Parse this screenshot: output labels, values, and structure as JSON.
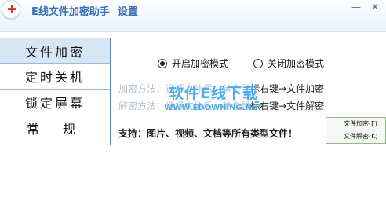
{
  "titlebar": {
    "title": "E线文件加密助手",
    "settings": "设置",
    "minimize_glyph": "—",
    "close_glyph": "✕"
  },
  "sidebar": {
    "items": [
      {
        "label": "文件加密",
        "active": true
      },
      {
        "label": "定时关机",
        "active": false
      },
      {
        "label": "锁定屏幕",
        "active": false
      },
      {
        "label": "常规",
        "active": false
      }
    ]
  },
  "panel": {
    "modes": [
      {
        "label": "开启加密模式",
        "selected": true
      },
      {
        "label": "关闭加密模式",
        "selected": false
      }
    ],
    "encrypt_hint_prefix": "加密方法：选择文件后，单击鼠",
    "encrypt_hint": "标右键→文件加密",
    "decrypt_hint_prefix": "解密方法：选择文件后，单击鼠",
    "decrypt_hint": "标右键→文件解密",
    "support": "支持：图片、视频、文档等所有类型文件！"
  },
  "watermark": {
    "main": "软件E线下载",
    "sub": "WWW.EDOWNING.NET"
  },
  "context_menu": {
    "items": [
      "文件加密(F)",
      "文件解密(K)"
    ]
  },
  "colors": {
    "title": "#3a6fb8",
    "sidebar_active": "#d6e6f4",
    "watermark": "#3aa6e8",
    "menu_border": "#8dbb7a"
  }
}
